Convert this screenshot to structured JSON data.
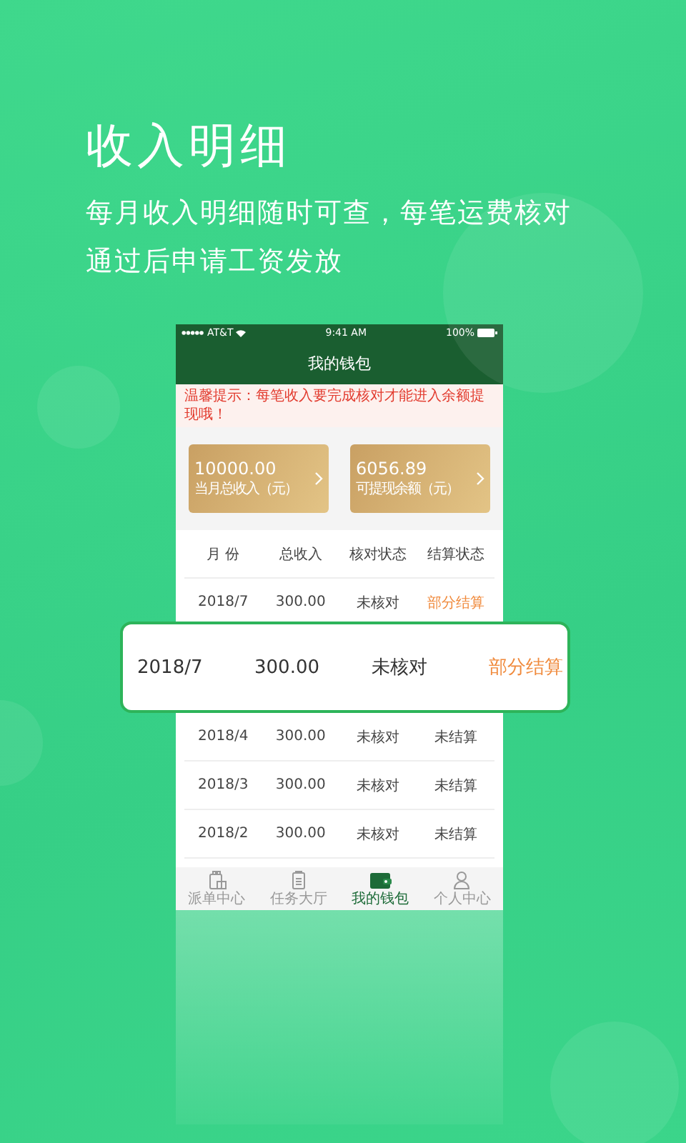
{
  "headline": {
    "title": "收入明细",
    "lines": [
      "每月收入明细随时可查，每笔运费核对",
      "通过后申请工资发放"
    ]
  },
  "phone": {
    "status_bar": {
      "carrier": "AT&T",
      "time": "9:41 AM",
      "battery": "100%"
    },
    "nav_title": "我的钱包",
    "notice": "温馨提示：每笔收入要完成核对才能进入余额提现哦！",
    "cards": [
      {
        "amount": "10000.00",
        "label": "当月总收入（元）"
      },
      {
        "amount": "6056.89",
        "label": "可提现余额（元）"
      }
    ],
    "table": {
      "columns": [
        "月 份",
        "总收入",
        "核对状态",
        "结算状态"
      ],
      "rows": [
        {
          "month": "2018/7",
          "income": "300.00",
          "check": "未核对",
          "settle": "部分结算",
          "kind": "partial"
        },
        {
          "month": "2018/4",
          "income": "300.00",
          "check": "未核对",
          "settle": "未结算",
          "kind": "none"
        },
        {
          "month": "2018/3",
          "income": "300.00",
          "check": "未核对",
          "settle": "未结算",
          "kind": "none"
        },
        {
          "month": "2018/2",
          "income": "300.00",
          "check": "未核对",
          "settle": "未结算",
          "kind": "none"
        }
      ]
    },
    "tabs": [
      {
        "label": "派单中心",
        "selected": false
      },
      {
        "label": "任务大厅",
        "selected": false
      },
      {
        "label": "我的钱包",
        "selected": true
      },
      {
        "label": "个人中心",
        "selected": false
      }
    ]
  },
  "popup_row": {
    "month": "2018/7",
    "income": "300.00",
    "check": "未核对",
    "settle": "部分结算",
    "kind": "partial"
  }
}
